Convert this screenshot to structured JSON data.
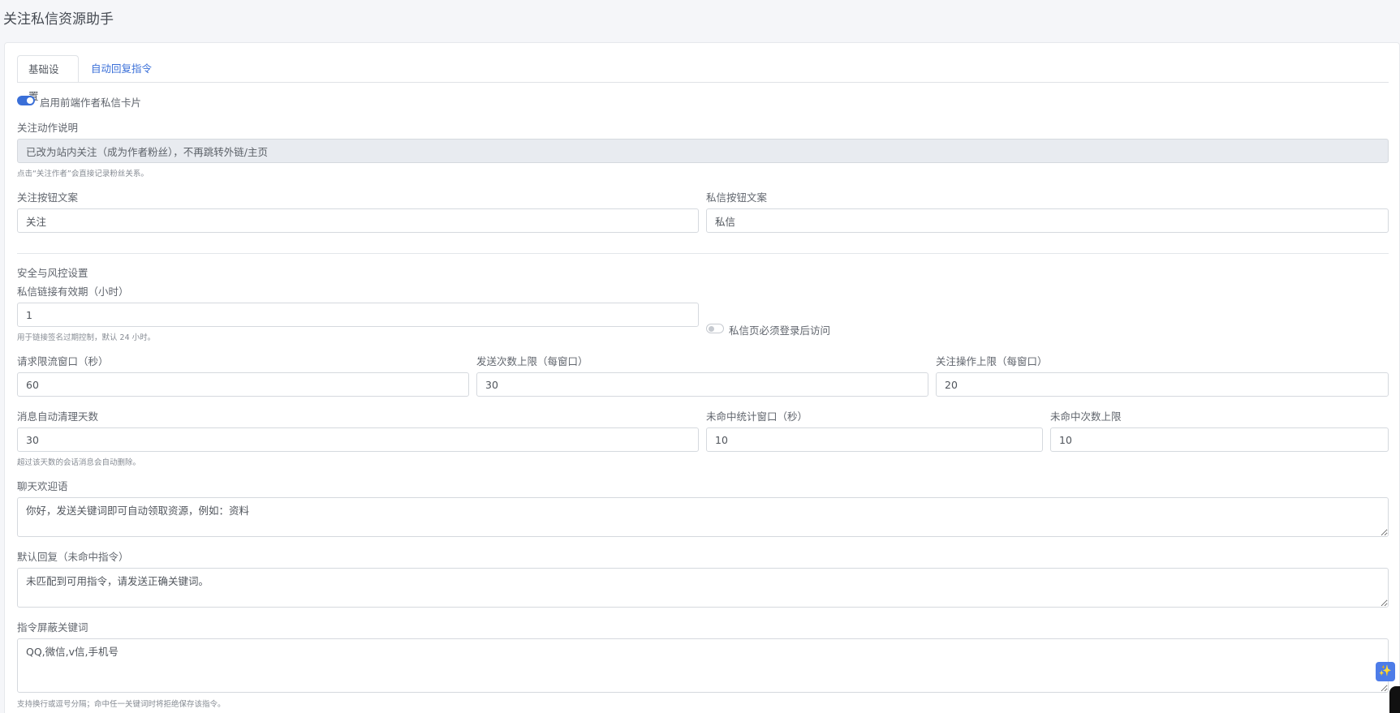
{
  "page": {
    "title": "关注私信资源助手"
  },
  "tabs": [
    {
      "label": "基础设置",
      "active": true
    },
    {
      "label": "自动回复指令",
      "active": false
    }
  ],
  "basic": {
    "enable_card_label": "启用前端作者私信卡片",
    "enable_card_on": true,
    "follow_desc_label": "关注动作说明",
    "follow_desc_value": "已改为站内关注（成为作者粉丝），不再跳转外链/主页",
    "follow_desc_hint": "点击“关注作者”会直接记录粉丝关系。",
    "follow_btn_label": "关注按钮文案",
    "follow_btn_value": "关注",
    "dm_btn_label": "私信按钮文案",
    "dm_btn_value": "私信"
  },
  "security": {
    "section_title": "安全与风控设置",
    "link_ttl_label": "私信链接有效期（小时）",
    "link_ttl_value": "1",
    "link_ttl_hint": "用于链接签名过期控制，默认 24 小时。",
    "require_login_label": "私信页必须登录后访问",
    "require_login_on": false,
    "rate_window_label": "请求限流窗口（秒）",
    "rate_window_value": "60",
    "send_limit_label": "发送次数上限（每窗口）",
    "send_limit_value": "30",
    "follow_limit_label": "关注操作上限（每窗口）",
    "follow_limit_value": "20",
    "cleanup_days_label": "消息自动清理天数",
    "cleanup_days_value": "30",
    "cleanup_days_hint": "超过该天数的会话消息会自动删除。",
    "miss_window_label": "未命中统计窗口（秒）",
    "miss_window_value": "10",
    "miss_limit_label": "未命中次数上限",
    "miss_limit_value": "10"
  },
  "messages": {
    "welcome_label": "聊天欢迎语",
    "welcome_value": "你好，发送关键词即可自动领取资源，例如：资料",
    "default_reply_label": "默认回复（未命中指令）",
    "default_reply_value": "未匹配到可用指令，请发送正确关键词。",
    "blocked_label": "指令屏蔽关键词",
    "blocked_value": "QQ,微信,v信,手机号",
    "blocked_hint": "支持换行或逗号分隔；命中任一关键词时将拒绝保存该指令。"
  },
  "fab": {
    "icon": "sparkle-icon",
    "glyph": "✨"
  }
}
